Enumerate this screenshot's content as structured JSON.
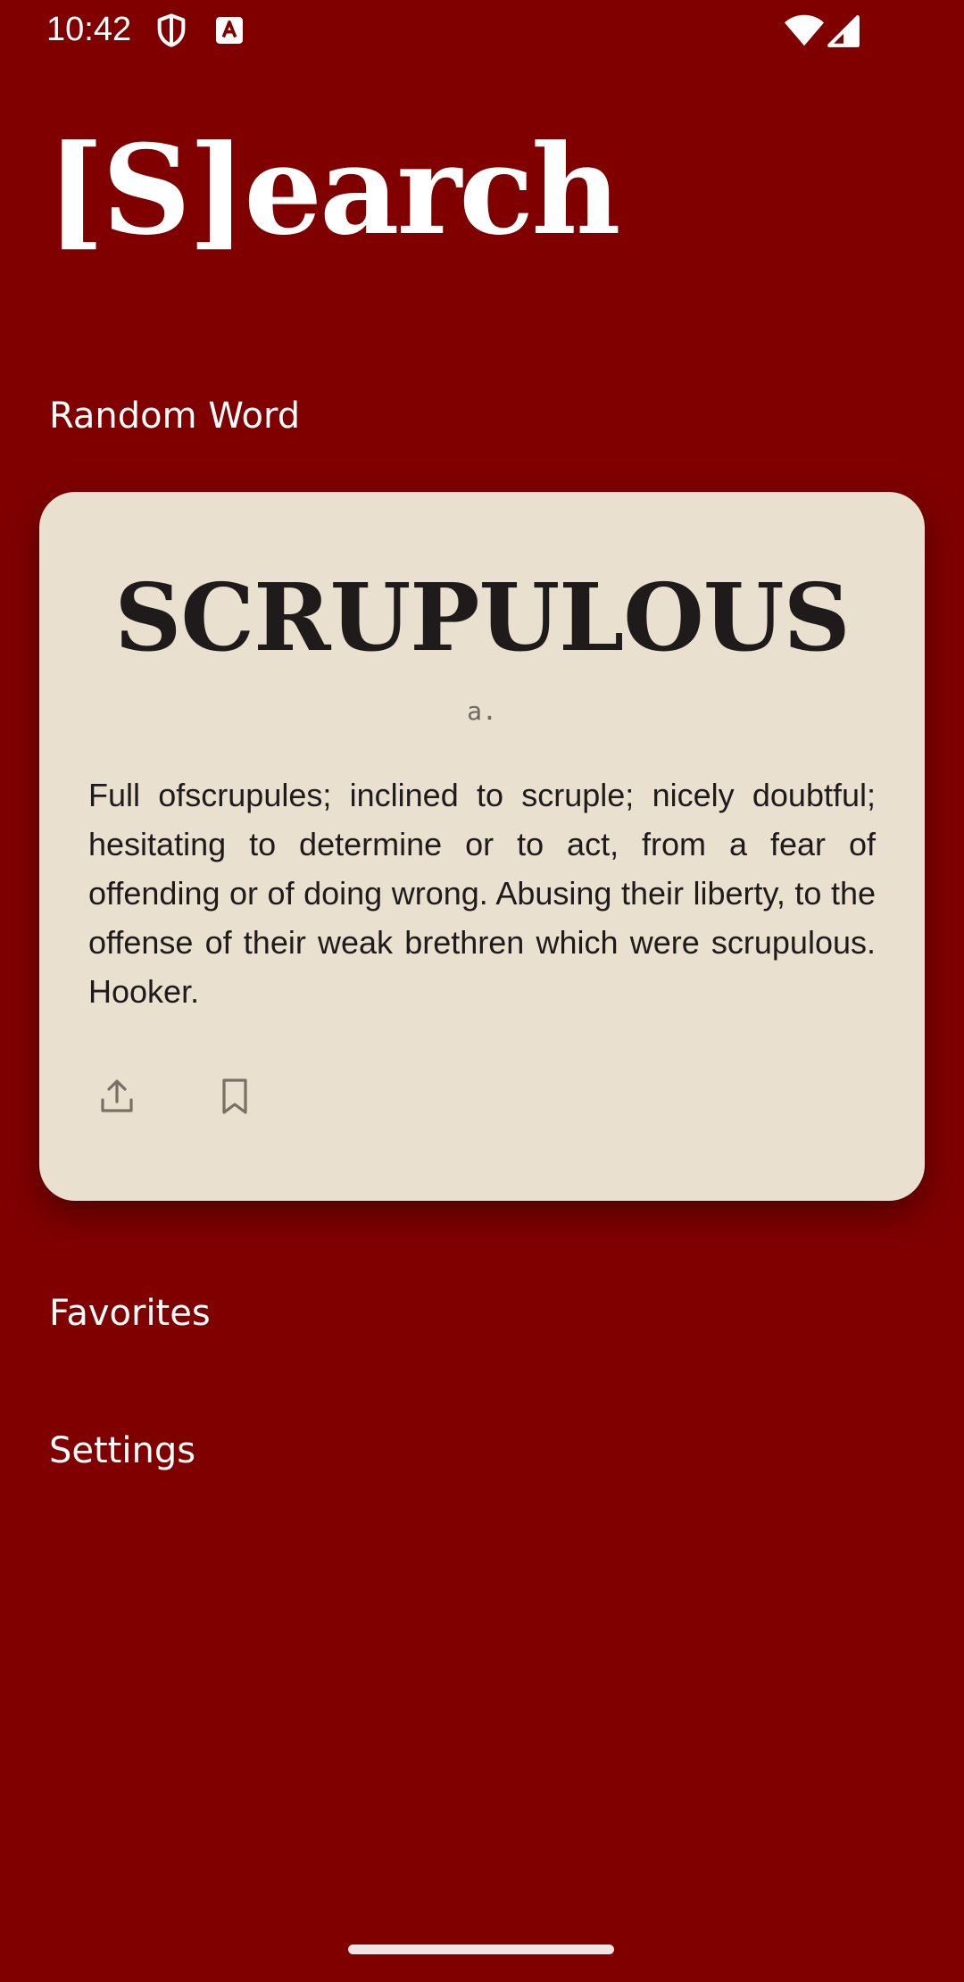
{
  "status_bar": {
    "time": "10:42",
    "icons": [
      "shield-icon",
      "text-a-icon",
      "wifi-icon",
      "signal-icon"
    ]
  },
  "app": {
    "title": "[S]earch",
    "colors": {
      "background": "#800000",
      "card": "#eae0cf",
      "card_text": "#1f1b1a",
      "muted_text": "#6e6863"
    }
  },
  "random_word": {
    "section_label": "Random Word",
    "word": "SCRUPULOUS",
    "part_of_speech": "a.",
    "definition": "Full ofscrupules; inclined to scruple; nicely doubtful; hesitating to determine or to act, from a fear of offending or of doing wrong. Abusing their liberty, to the offense of their weak brethren which were scrupulous. Hooker.",
    "actions": [
      "share-icon",
      "bookmark-icon"
    ]
  },
  "nav": {
    "favorites": "Favorites",
    "settings": "Settings"
  }
}
